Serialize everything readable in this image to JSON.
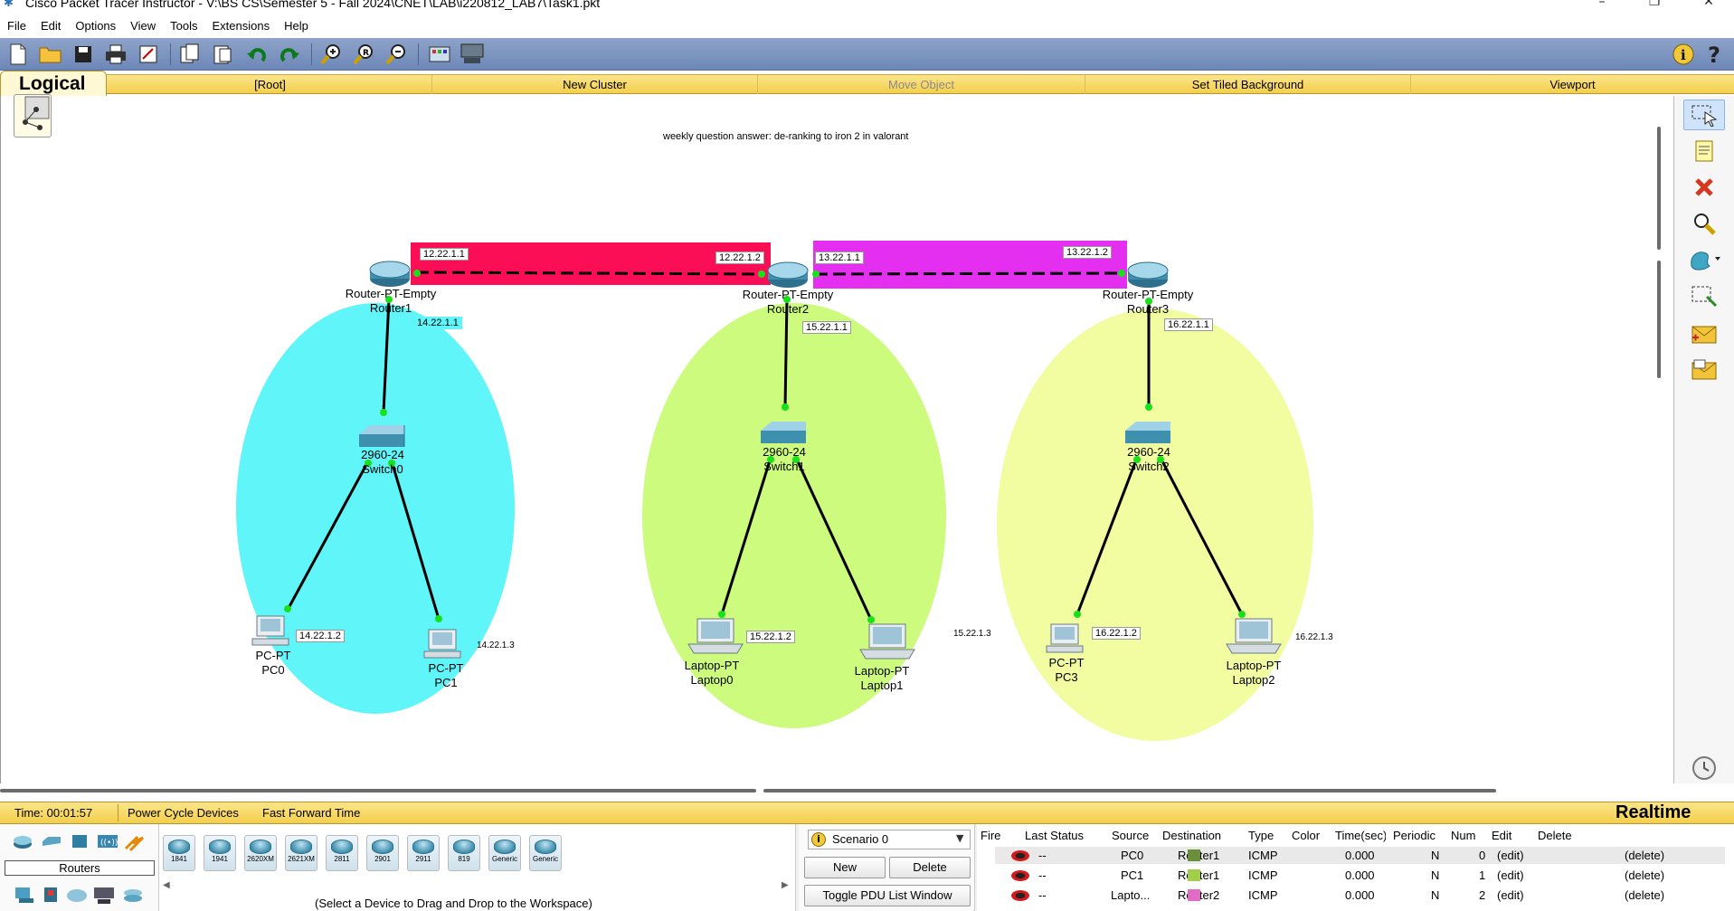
{
  "window": {
    "title": "Cisco Packet Tracer Instructor - V:\\BS CS\\Semester 5 - Fall 2024\\CNET\\LAB\\i220812_LAB7\\Task1.pkt"
  },
  "menu": [
    "File",
    "Edit",
    "Options",
    "View",
    "Tools",
    "Extensions",
    "Help"
  ],
  "workspace_bar": {
    "tab": "Logical",
    "items": [
      "[Root]",
      "New Cluster",
      "Move Object",
      "Set Tiled Background",
      "Viewport"
    ]
  },
  "canvas": {
    "note": "weekly question answer: de-ranking to iron 2 in valorant",
    "routers": [
      {
        "model": "Router-PT-Empty",
        "name": "Router1"
      },
      {
        "model": "Router-PT-Empty",
        "name": "Router2"
      },
      {
        "model": "Router-PT-Empty",
        "name": "Router3"
      }
    ],
    "switches": [
      {
        "model": "2960-24",
        "name": "Switch0"
      },
      {
        "model": "2960-24",
        "name": "Switch1"
      },
      {
        "model": "2960-24",
        "name": "Switch2"
      }
    ],
    "end_devices": [
      {
        "model": "PC-PT",
        "name": "PC0",
        "ip": "14.22.1.2"
      },
      {
        "model": "PC-PT",
        "name": "PC1",
        "ip": "14.22.1.3"
      },
      {
        "model": "Laptop-PT",
        "name": "Laptop0",
        "ip": "15.22.1.2"
      },
      {
        "model": "Laptop-PT",
        "name": "Laptop1",
        "ip": "15.22.1.3"
      },
      {
        "model": "PC-PT",
        "name": "PC3",
        "ip": "16.22.1.2"
      },
      {
        "model": "Laptop-PT",
        "name": "Laptop2",
        "ip": "16.22.1.3"
      }
    ],
    "link_labels": {
      "r1_r2_left": "12.22.1.1",
      "r1_r2_right": "12.22.1.2",
      "r2_r3_left": "13.22.1.1",
      "r2_r3_right": "13.22.1.2",
      "r1_lan": "14.22.1.1",
      "r2_lan": "15.22.1.1",
      "r3_lan": "16.22.1.1"
    },
    "colors": {
      "zone_cyan": "#5ff5f9",
      "zone_green": "#ccfb7d",
      "zone_yellow": "#f2fca1",
      "wan1": "#fb0e55",
      "wan2": "#e52ff0"
    }
  },
  "status": {
    "time": "Time: 00:01:57",
    "power_cycle": "Power Cycle Devices",
    "fast_forward": "Fast Forward Time",
    "mode": "Realtime"
  },
  "device_panel": {
    "category": "Routers",
    "models": [
      "1841",
      "1941",
      "2620XM",
      "2621XM",
      "2811",
      "2901",
      "2911",
      "819",
      "Generic",
      "Generic"
    ],
    "hint": "(Select a Device to Drag and Drop to the Workspace)"
  },
  "scenario": {
    "selected": "Scenario 0",
    "new": "New",
    "delete": "Delete",
    "toggle": "Toggle PDU List Window"
  },
  "pdu_table": {
    "headers": [
      "Fire",
      "Last Status",
      "Source",
      "Destination",
      "Type",
      "Color",
      "Time(sec)",
      "Periodic",
      "Num",
      "Edit",
      "Delete"
    ],
    "rows": [
      {
        "last_status": "--",
        "source": "PC0",
        "destination": "Router1",
        "type": "ICMP",
        "color": "#6a8f3a",
        "time": "0.000",
        "periodic": "N",
        "num": "0",
        "edit": "(edit)",
        "delete": "(delete)"
      },
      {
        "last_status": "--",
        "source": "PC1",
        "destination": "Router1",
        "type": "ICMP",
        "color": "#a2cf4a",
        "time": "0.000",
        "periodic": "N",
        "num": "1",
        "edit": "(edit)",
        "delete": "(delete)"
      },
      {
        "last_status": "--",
        "source": "Lapto...",
        "destination": "Router2",
        "type": "ICMP",
        "color": "#e26bc7",
        "time": "0.000",
        "periodic": "N",
        "num": "2",
        "edit": "(edit)",
        "delete": "(delete)"
      }
    ]
  }
}
